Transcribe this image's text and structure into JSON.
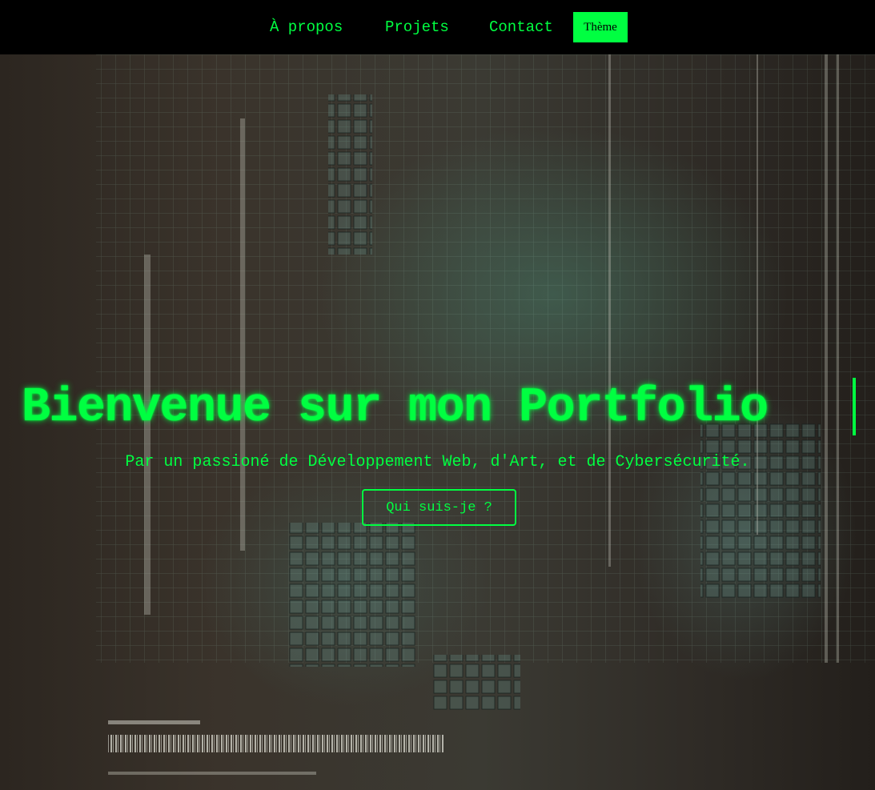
{
  "nav": {
    "links": [
      "À propos",
      "Projets",
      "Contact"
    ],
    "theme_label": "Thème"
  },
  "hero": {
    "title": "Bienvenue sur mon Portfolio",
    "subtitle": "Par un passioné de Développement Web, d'Art, et de Cybersécurité.",
    "cta_label": "Qui suis-je ?"
  },
  "colors": {
    "accent": "#00ff41",
    "nav_background": "#000000"
  }
}
